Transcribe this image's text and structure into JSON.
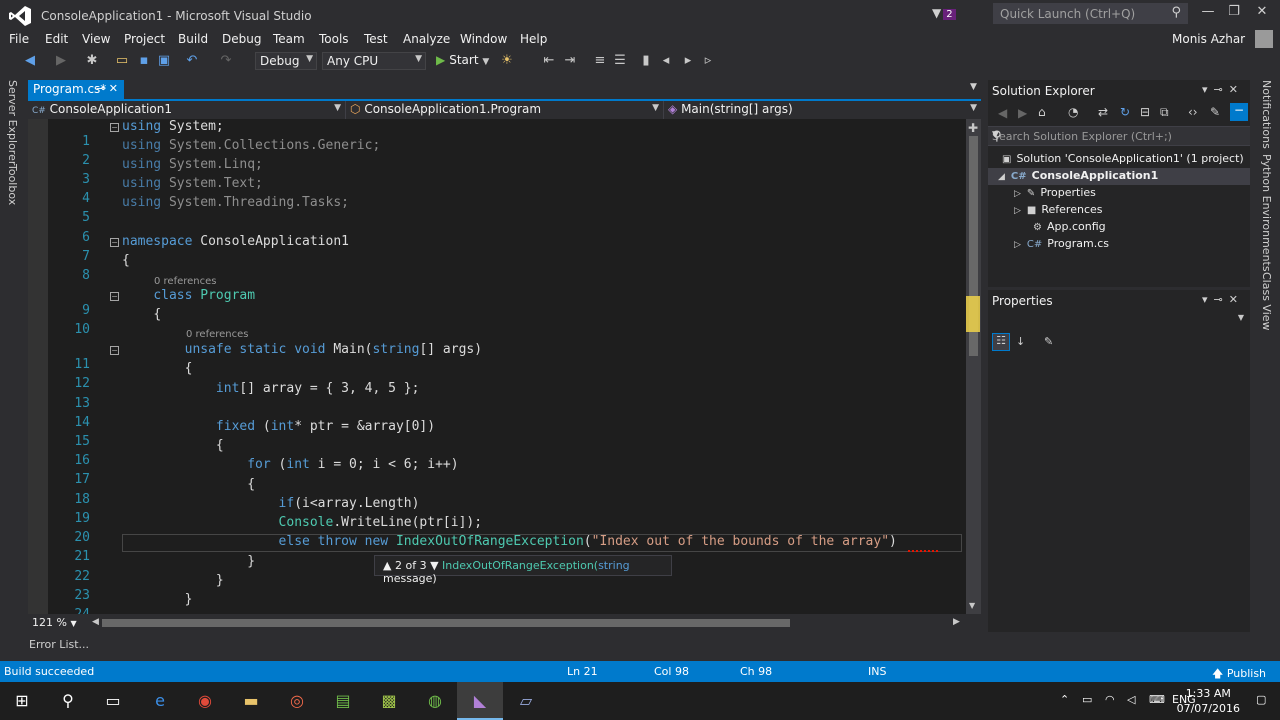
{
  "window": {
    "title": "ConsoleApplication1 - Microsoft Visual Studio",
    "notifications_count": "2",
    "quick_launch_placeholder": "Quick Launch (Ctrl+Q)",
    "user_name": "Monis Azhar"
  },
  "menu": [
    "File",
    "Edit",
    "View",
    "Project",
    "Build",
    "Debug",
    "Team",
    "Tools",
    "Test",
    "Analyze",
    "Window",
    "Help"
  ],
  "toolbar": {
    "config": "Debug",
    "platform": "Any CPU",
    "start_label": "Start"
  },
  "left_strip": [
    "Server Explorer",
    "Toolbox"
  ],
  "right_strip": [
    "Notifications",
    "Python Environments",
    "Class View"
  ],
  "document_tab": "Program.cs*",
  "navbar": {
    "project": "ConsoleApplication1",
    "type": "ConsoleApplication1.Program",
    "member": "Main(string[] args)"
  },
  "code": {
    "lines": [
      {
        "n": "1"
      },
      {
        "n": "2"
      },
      {
        "n": "3"
      },
      {
        "n": "4"
      },
      {
        "n": "5"
      },
      {
        "n": "6"
      },
      {
        "n": "7"
      },
      {
        "n": "8"
      },
      {
        "n": "9"
      },
      {
        "n": "10"
      },
      {
        "n": "11"
      },
      {
        "n": "12"
      },
      {
        "n": "13"
      },
      {
        "n": "14"
      },
      {
        "n": "15"
      },
      {
        "n": "16"
      },
      {
        "n": "17"
      },
      {
        "n": "18"
      },
      {
        "n": "19"
      },
      {
        "n": "20"
      },
      {
        "n": "21"
      },
      {
        "n": "22"
      },
      {
        "n": "23"
      },
      {
        "n": "24"
      }
    ],
    "t": {
      "using": "using",
      "ns_system": "System;",
      "ns_collections": "System.Collections.Generic;",
      "ns_linq": "System.Linq;",
      "ns_text": "System.Text;",
      "ns_tasks": "System.Threading.Tasks;",
      "namespace_kw": "namespace",
      "namespace_name": "ConsoleApplication1",
      "open_brace": "{",
      "close_brace": "}",
      "refs": "0 references",
      "class_kw": "class",
      "class_name": "Program",
      "unsafe_kw": "unsafe static void",
      "main_sig_a": "Main(",
      "string_kw": "string",
      "main_sig_b": "[] args)",
      "int_kw": "int",
      "array_decl": "[] array = { 3, 4, 5 };",
      "fixed_kw": "fixed",
      "fixed_a": " (",
      "fixed_b": "* ptr = &array[0])",
      "for_kw": "for",
      "for_a": " (",
      "for_b": " i = 0; i < 6; i++)",
      "if_kw": "if",
      "if_rest": "(i<array.Length)",
      "console": "Console",
      "writeline": ".WriteLine(ptr[i]);",
      "else_kw": "else throw new",
      "exception_type": "IndexOutOfRangeException",
      "paren_open": "(",
      "string_lit": "\"Index out of the bounds of the array\"",
      "paren_close": ")"
    }
  },
  "signature_help": {
    "counter": "2 of 3",
    "method": "IndexOutOfRangeException(",
    "param_type": "string",
    "param_name": " message)"
  },
  "zoom": "121 %",
  "error_list": "Error List...",
  "solution_explorer": {
    "title": "Solution Explorer",
    "search_placeholder": "Search Solution Explorer (Ctrl+;)",
    "items": [
      {
        "label": "Solution 'ConsoleApplication1' (1 project)"
      },
      {
        "label": "ConsoleApplication1"
      },
      {
        "label": "Properties"
      },
      {
        "label": "References"
      },
      {
        "label": "App.config"
      },
      {
        "label": "Program.cs"
      }
    ]
  },
  "properties_panel": {
    "title": "Properties"
  },
  "status": {
    "message": "Build succeeded",
    "ln": "Ln 21",
    "col": "Col 98",
    "ch": "Ch 98",
    "mode": "INS",
    "publish": "Publish"
  },
  "taskbar": {
    "lang": "ENG",
    "time": "1:33 AM",
    "date": "07/07/2016"
  },
  "colors": {
    "accent": "#007acc",
    "keyword": "#569cd6",
    "type": "#4ec9b0",
    "string": "#d69d85",
    "line_number": "#2b91af"
  }
}
